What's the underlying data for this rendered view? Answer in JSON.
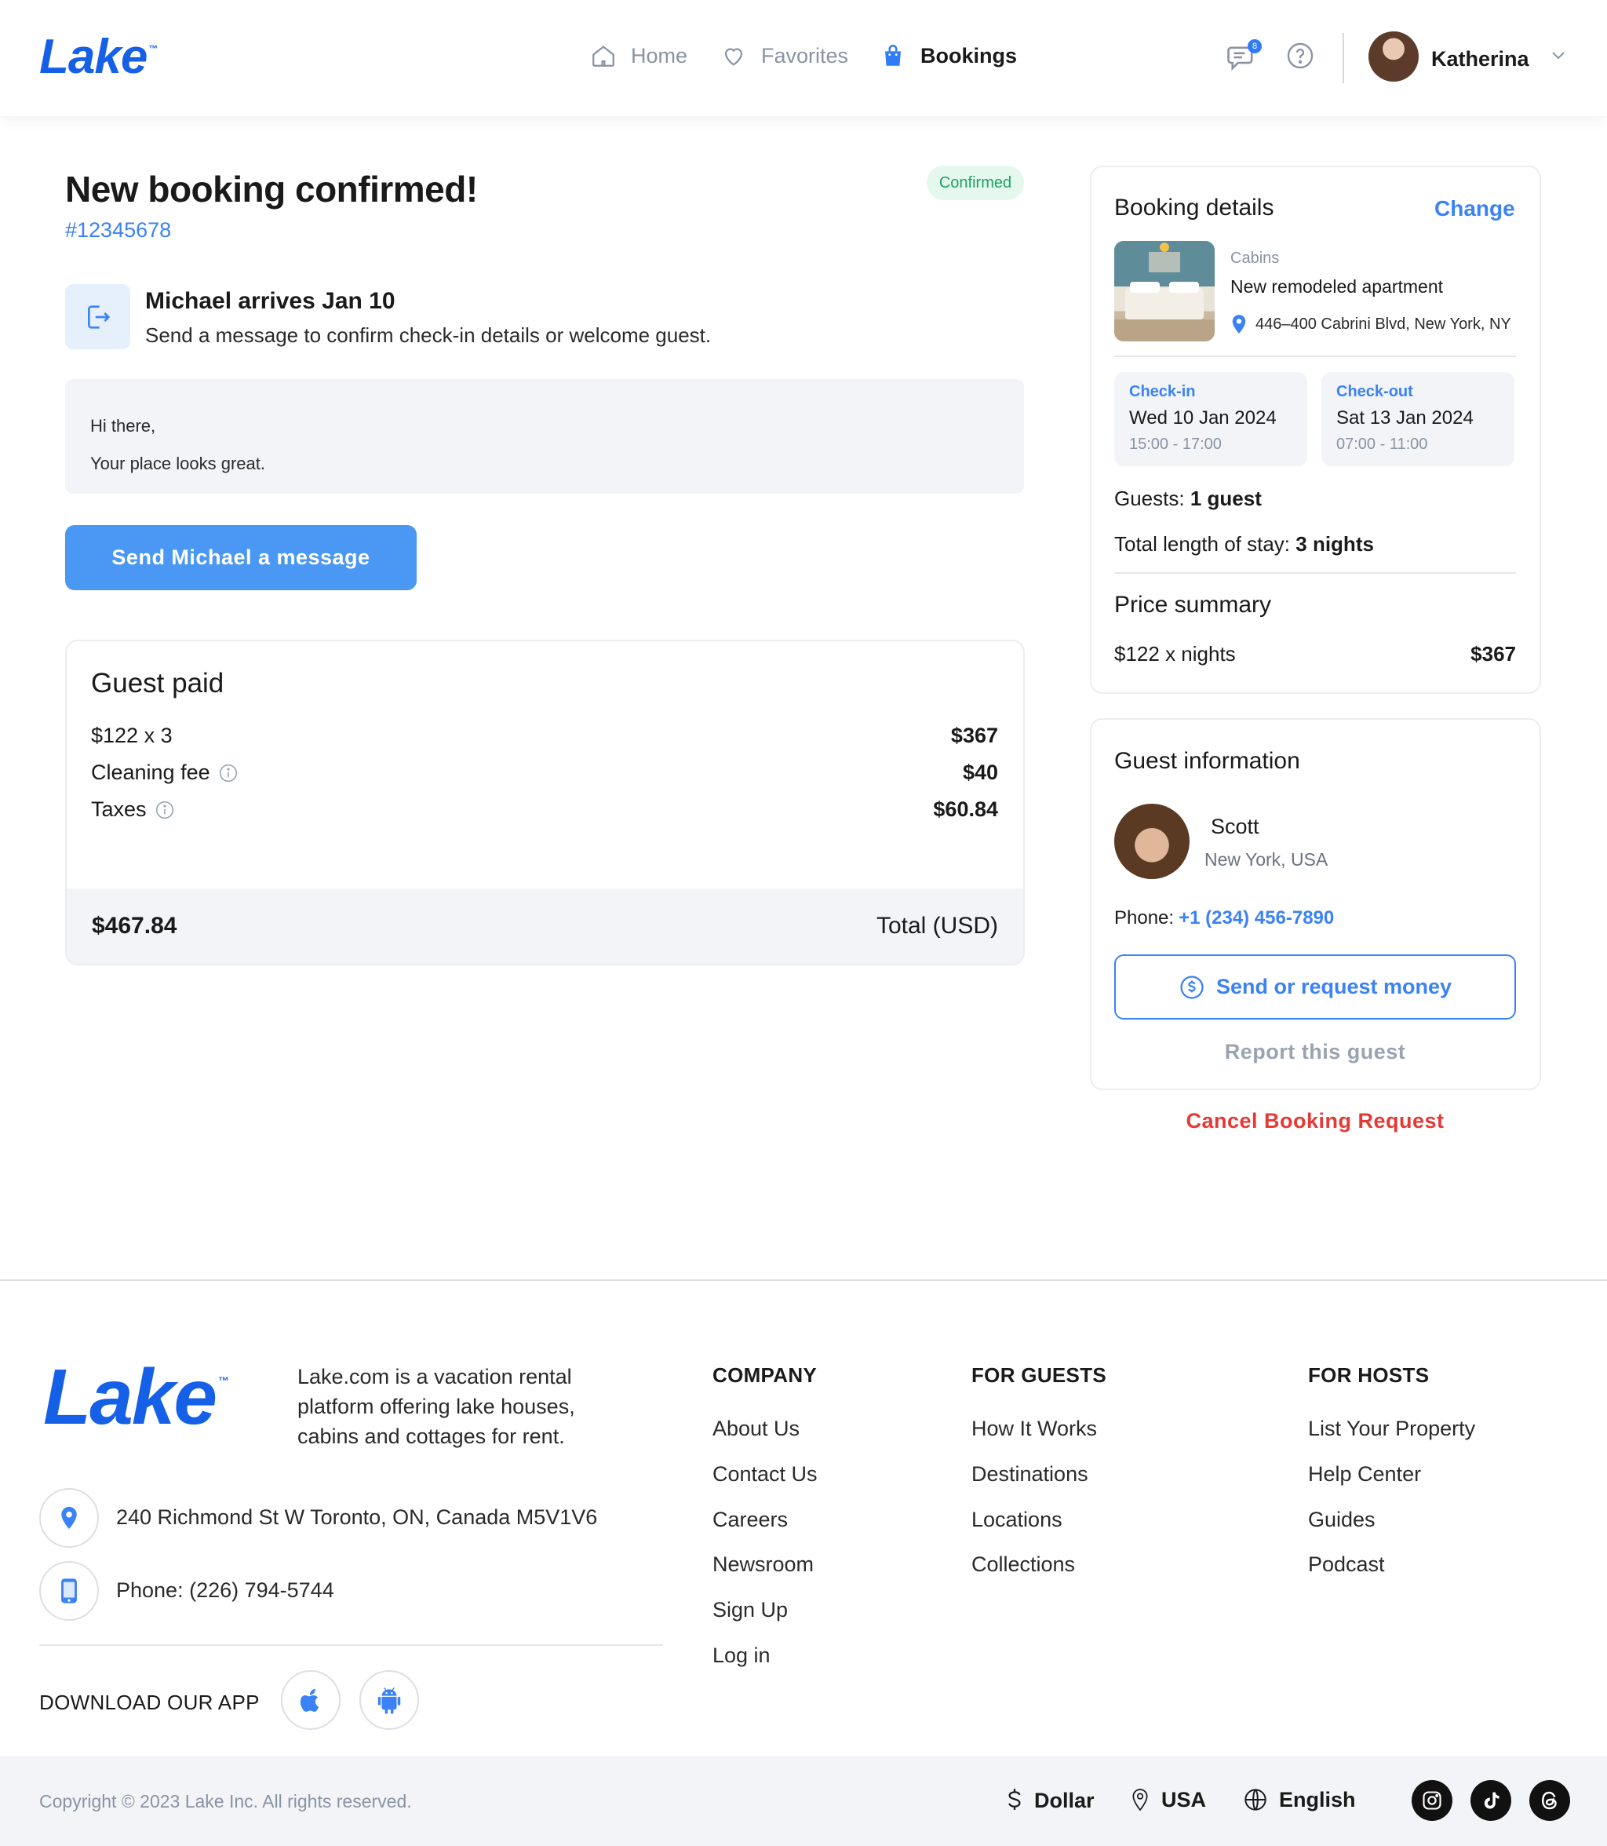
{
  "header": {
    "logo": "Lake",
    "logo_tm": "™",
    "nav": [
      {
        "label": "Home",
        "icon": "home-icon"
      },
      {
        "label": "Favorites",
        "icon": "heart-icon"
      },
      {
        "label": "Bookings",
        "icon": "bag-icon",
        "active": true
      }
    ],
    "messages_badge": "8",
    "user_name": "Katherina"
  },
  "booking": {
    "title": "New booking confirmed!",
    "id": "#12345678",
    "status": "Confirmed",
    "arrival_title": "Michael arrives Jan 10",
    "arrival_sub": "Send a message to confirm check-in details or welcome guest.",
    "message_line1": "Hi there,",
    "message_line2": "Your place looks great.",
    "send_button": "Send Michael a message"
  },
  "guest_paid": {
    "title": "Guest paid",
    "rows": [
      {
        "label": "$122 x 3",
        "amount": "$367"
      },
      {
        "label": "Cleaning fee",
        "amount": "$40"
      },
      {
        "label": "Taxes",
        "amount": "$60.84"
      }
    ],
    "total_amount": "$467.84",
    "total_label": "Total (USD)"
  },
  "booking_details": {
    "title": "Booking details",
    "change": "Change",
    "category": "Cabins",
    "name": "New remodeled apartment",
    "address": "446–400 Cabrini Blvd, New York, NY",
    "checkin_label": "Check-in",
    "checkin_date": "Wed 10 Jan 2024",
    "checkin_time": "15:00 - 17:00",
    "checkout_label": "Check-out",
    "checkout_date": "Sat 13 Jan 2024",
    "checkout_time": "07:00 - 11:00",
    "guests_label": "Guests:",
    "guests_value": "1 guest",
    "stay_label": "Total length of stay:",
    "stay_value": "3 nights",
    "price_title": "Price summary",
    "price_label": "$122 x  nights",
    "price_value": "$367"
  },
  "guest_info": {
    "title": "Guest information",
    "name": "Scott",
    "location": "New York, USA",
    "phone_label": "Phone:",
    "phone": "+1 (234) 456-7890",
    "money_button": "Send or request money",
    "report": "Report this guest",
    "cancel": "Cancel Booking Request"
  },
  "footer": {
    "logo": "Lake",
    "logo_tm": "™",
    "description": "Lake.com is a vacation rental platform offering lake houses, cabins and cottages for rent.",
    "address": "240 Richmond St W Toronto, ON, Canada M5V1V6",
    "phone": "Phone: (226) 794-5744",
    "download": "DOWNLOAD OUR APP",
    "company_title": "COMPANY",
    "company_links": [
      "About Us",
      "Contact Us",
      "Careers",
      "Newsroom",
      "Sign Up",
      "Log in"
    ],
    "guests_title": "FOR GUESTS",
    "guests_links": [
      "How It Works",
      "Destinations",
      "Locations",
      "Collections"
    ],
    "hosts_title": "FOR HOSTS",
    "hosts_links": [
      "List Your Property",
      "Help Center",
      "Guides",
      "Podcast"
    ],
    "copyright": "Copyright © 2023 Lake Inc. All rights reserved.",
    "currency": "Dollar",
    "country": "USA",
    "language": "English"
  },
  "colors": {
    "brand": "#1660e8",
    "accent": "#3b82f6",
    "success": "#1ba35f",
    "danger": "#e53935"
  }
}
